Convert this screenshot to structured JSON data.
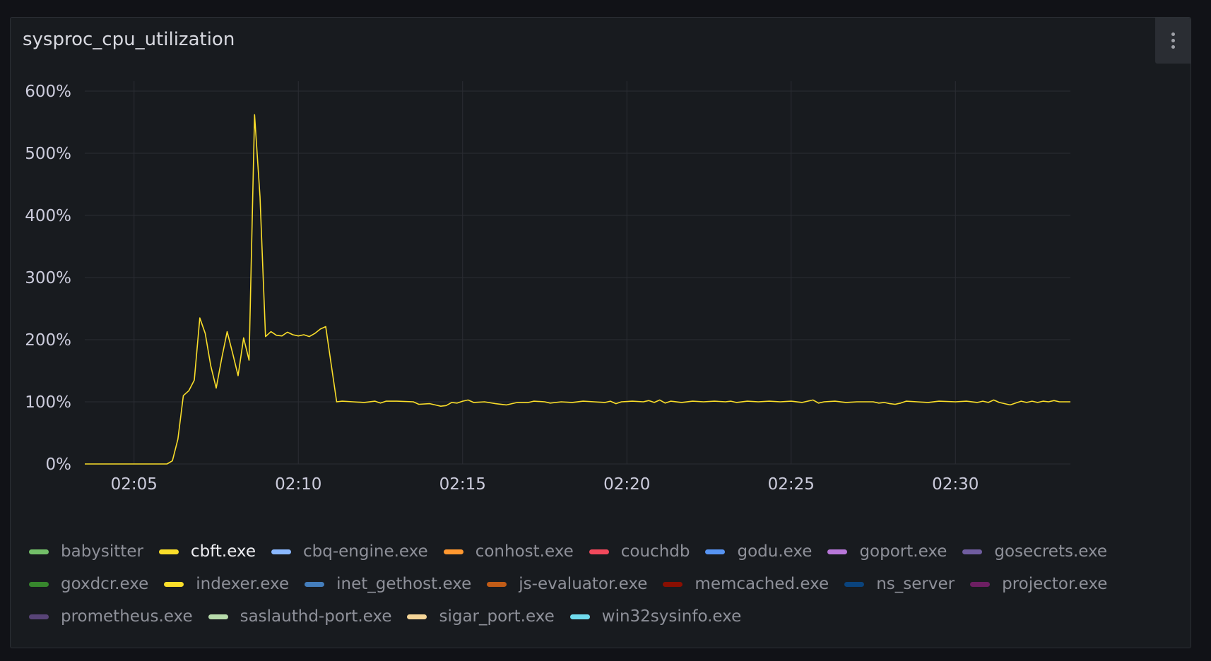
{
  "panel": {
    "title": "sysproc_cpu_utilization",
    "menu_icon": "kebab-menu-icon"
  },
  "chart_data": {
    "type": "line",
    "title": "sysproc_cpu_utilization",
    "xlabel": "",
    "ylabel": "",
    "x_range": [
      "02:03:30",
      "02:33:30"
    ],
    "ylim": [
      0,
      600
    ],
    "yticks": [
      "0%",
      "100%",
      "200%",
      "300%",
      "400%",
      "500%",
      "600%"
    ],
    "ytick_values": [
      0,
      100,
      200,
      300,
      400,
      500,
      600
    ],
    "xticks": [
      "02:05",
      "02:10",
      "02:15",
      "02:20",
      "02:25",
      "02:30"
    ],
    "xtick_values": [
      "02:05",
      "02:10",
      "02:15",
      "02:20",
      "02:25",
      "02:30"
    ],
    "grid": true,
    "legend_position": "bottom",
    "series": [
      {
        "name": "cbft.exe",
        "color": "#fade2a",
        "points": [
          [
            "02:03:30",
            0
          ],
          [
            "02:05:00",
            0
          ],
          [
            "02:06:00",
            0
          ],
          [
            "02:06:10",
            5
          ],
          [
            "02:06:20",
            40
          ],
          [
            "02:06:30",
            110
          ],
          [
            "02:06:40",
            118
          ],
          [
            "02:06:50",
            135
          ],
          [
            "02:07:00",
            235
          ],
          [
            "02:07:10",
            210
          ],
          [
            "02:07:20",
            158
          ],
          [
            "02:07:30",
            122
          ],
          [
            "02:07:40",
            170
          ],
          [
            "02:07:50",
            213
          ],
          [
            "02:08:00",
            178
          ],
          [
            "02:08:10",
            142
          ],
          [
            "02:08:20",
            203
          ],
          [
            "02:08:30",
            167
          ],
          [
            "02:08:40",
            562
          ],
          [
            "02:08:50",
            430
          ],
          [
            "02:09:00",
            205
          ],
          [
            "02:09:10",
            213
          ],
          [
            "02:09:20",
            207
          ],
          [
            "02:09:30",
            206
          ],
          [
            "02:09:40",
            212
          ],
          [
            "02:09:50",
            208
          ],
          [
            "02:10:00",
            206
          ],
          [
            "02:10:10",
            208
          ],
          [
            "02:10:20",
            205
          ],
          [
            "02:10:30",
            210
          ],
          [
            "02:10:40",
            217
          ],
          [
            "02:10:50",
            221
          ],
          [
            "02:11:00",
            160
          ],
          [
            "02:11:10",
            100
          ],
          [
            "02:11:20",
            101
          ],
          [
            "02:11:40",
            100
          ],
          [
            "02:12:00",
            99
          ],
          [
            "02:12:20",
            101
          ],
          [
            "02:12:30",
            98
          ],
          [
            "02:12:40",
            101
          ],
          [
            "02:13:00",
            101
          ],
          [
            "02:13:30",
            100
          ],
          [
            "02:13:40",
            96
          ],
          [
            "02:14:00",
            97
          ],
          [
            "02:14:10",
            95
          ],
          [
            "02:14:20",
            93
          ],
          [
            "02:14:30",
            94
          ],
          [
            "02:14:40",
            99
          ],
          [
            "02:14:50",
            98
          ],
          [
            "02:15:00",
            101
          ],
          [
            "02:15:10",
            103
          ],
          [
            "02:15:20",
            99
          ],
          [
            "02:15:40",
            100
          ],
          [
            "02:16:00",
            97
          ],
          [
            "02:16:20",
            95
          ],
          [
            "02:16:30",
            97
          ],
          [
            "02:16:40",
            99
          ],
          [
            "02:17:00",
            99
          ],
          [
            "02:17:10",
            101
          ],
          [
            "02:17:30",
            100
          ],
          [
            "02:17:40",
            98
          ],
          [
            "02:18:00",
            100
          ],
          [
            "02:18:20",
            99
          ],
          [
            "02:18:40",
            101
          ],
          [
            "02:19:00",
            100
          ],
          [
            "02:19:20",
            99
          ],
          [
            "02:19:30",
            101
          ],
          [
            "02:19:40",
            97
          ],
          [
            "02:19:50",
            100
          ],
          [
            "02:20:10",
            101
          ],
          [
            "02:20:30",
            100
          ],
          [
            "02:20:40",
            102
          ],
          [
            "02:20:50",
            99
          ],
          [
            "02:21:00",
            103
          ],
          [
            "02:21:10",
            98
          ],
          [
            "02:21:20",
            101
          ],
          [
            "02:21:40",
            99
          ],
          [
            "02:22:00",
            101
          ],
          [
            "02:22:20",
            100
          ],
          [
            "02:22:40",
            101
          ],
          [
            "02:23:00",
            100
          ],
          [
            "02:23:10",
            101
          ],
          [
            "02:23:20",
            99
          ],
          [
            "02:23:40",
            101
          ],
          [
            "02:24:00",
            100
          ],
          [
            "02:24:20",
            101
          ],
          [
            "02:24:40",
            100
          ],
          [
            "02:25:00",
            101
          ],
          [
            "02:25:20",
            99
          ],
          [
            "02:25:30",
            101
          ],
          [
            "02:25:40",
            103
          ],
          [
            "02:25:50",
            98
          ],
          [
            "02:26:00",
            100
          ],
          [
            "02:26:20",
            101
          ],
          [
            "02:26:40",
            99
          ],
          [
            "02:27:00",
            100
          ],
          [
            "02:27:30",
            100
          ],
          [
            "02:27:40",
            98
          ],
          [
            "02:27:50",
            99
          ],
          [
            "02:28:00",
            97
          ],
          [
            "02:28:10",
            96
          ],
          [
            "02:28:20",
            98
          ],
          [
            "02:28:30",
            101
          ],
          [
            "02:28:50",
            100
          ],
          [
            "02:29:10",
            99
          ],
          [
            "02:29:30",
            101
          ],
          [
            "02:30:00",
            100
          ],
          [
            "02:30:20",
            101
          ],
          [
            "02:30:40",
            99
          ],
          [
            "02:30:50",
            101
          ],
          [
            "02:31:00",
            99
          ],
          [
            "02:31:10",
            103
          ],
          [
            "02:31:20",
            99
          ],
          [
            "02:31:30",
            97
          ],
          [
            "02:31:40",
            95
          ],
          [
            "02:31:50",
            98
          ],
          [
            "02:32:00",
            101
          ],
          [
            "02:32:10",
            99
          ],
          [
            "02:32:20",
            101
          ],
          [
            "02:32:30",
            99
          ],
          [
            "02:32:40",
            101
          ],
          [
            "02:32:50",
            100
          ],
          [
            "02:33:00",
            102
          ],
          [
            "02:33:10",
            100
          ],
          [
            "02:33:30",
            100
          ]
        ]
      }
    ]
  },
  "legend": [
    {
      "name": "babysitter",
      "color": "#73bf69",
      "active": false
    },
    {
      "name": "cbft.exe",
      "color": "#fade2a",
      "active": true
    },
    {
      "name": "cbq-engine.exe",
      "color": "#8ab8ff",
      "active": false
    },
    {
      "name": "conhost.exe",
      "color": "#ff9830",
      "active": false
    },
    {
      "name": "couchdb",
      "color": "#f2495c",
      "active": false
    },
    {
      "name": "godu.exe",
      "color": "#5794f2",
      "active": false
    },
    {
      "name": "goport.exe",
      "color": "#b877d9",
      "active": false
    },
    {
      "name": "gosecrets.exe",
      "color": "#705da0",
      "active": false
    },
    {
      "name": "goxdcr.exe",
      "color": "#37872d",
      "active": false
    },
    {
      "name": "indexer.exe",
      "color": "#fade2a",
      "active": false
    },
    {
      "name": "inet_gethost.exe",
      "color": "#447ebc",
      "active": false
    },
    {
      "name": "js-evaluator.exe",
      "color": "#c15c17",
      "active": false
    },
    {
      "name": "memcached.exe",
      "color": "#890f02",
      "active": false
    },
    {
      "name": "ns_server",
      "color": "#0a437c",
      "active": false
    },
    {
      "name": "projector.exe",
      "color": "#6d1f62",
      "active": false
    },
    {
      "name": "prometheus.exe",
      "color": "#584477",
      "active": false
    },
    {
      "name": "saslauthd-port.exe",
      "color": "#b7dbab",
      "active": false
    },
    {
      "name": "sigar_port.exe",
      "color": "#f4d598",
      "active": false
    },
    {
      "name": "win32sysinfo.exe",
      "color": "#70dbed",
      "active": false
    }
  ]
}
